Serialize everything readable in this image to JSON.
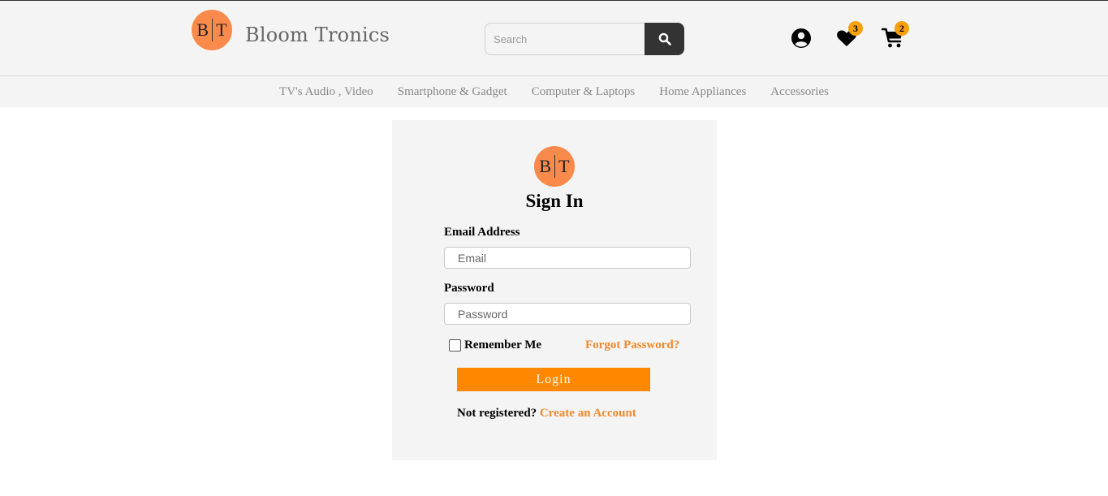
{
  "header": {
    "logo_left": "B",
    "logo_right": "T",
    "brand_name": "Bloom Tronics",
    "search_placeholder": "Search",
    "search_icon": "search-icon",
    "account_icon": "user-circle-icon",
    "wishlist_icon": "heart-icon",
    "wishlist_count": "3",
    "cart_icon": "cart-icon",
    "cart_count": "2"
  },
  "categories": [
    "TV's Audio , Video",
    "Smartphone & Gadget",
    "Computer & Laptops",
    "Home Appliances",
    "Accessories"
  ],
  "signin": {
    "logo_left": "B",
    "logo_right": "T",
    "title": "Sign In",
    "email_label": "Email Address",
    "email_placeholder": "Email",
    "password_label": "Password",
    "password_placeholder": "Password",
    "remember_label": "Remember Me",
    "remember_checked": false,
    "forgot_label": "Forgot Password?",
    "login_label": "Login",
    "not_registered": "Not registered?",
    "create_account": "Create an Account"
  },
  "colors": {
    "accent": "#ff8800",
    "link": "#f2882b",
    "logo": "#fa8a4b",
    "badge": "#f6a00b",
    "search_button": "#333333"
  }
}
